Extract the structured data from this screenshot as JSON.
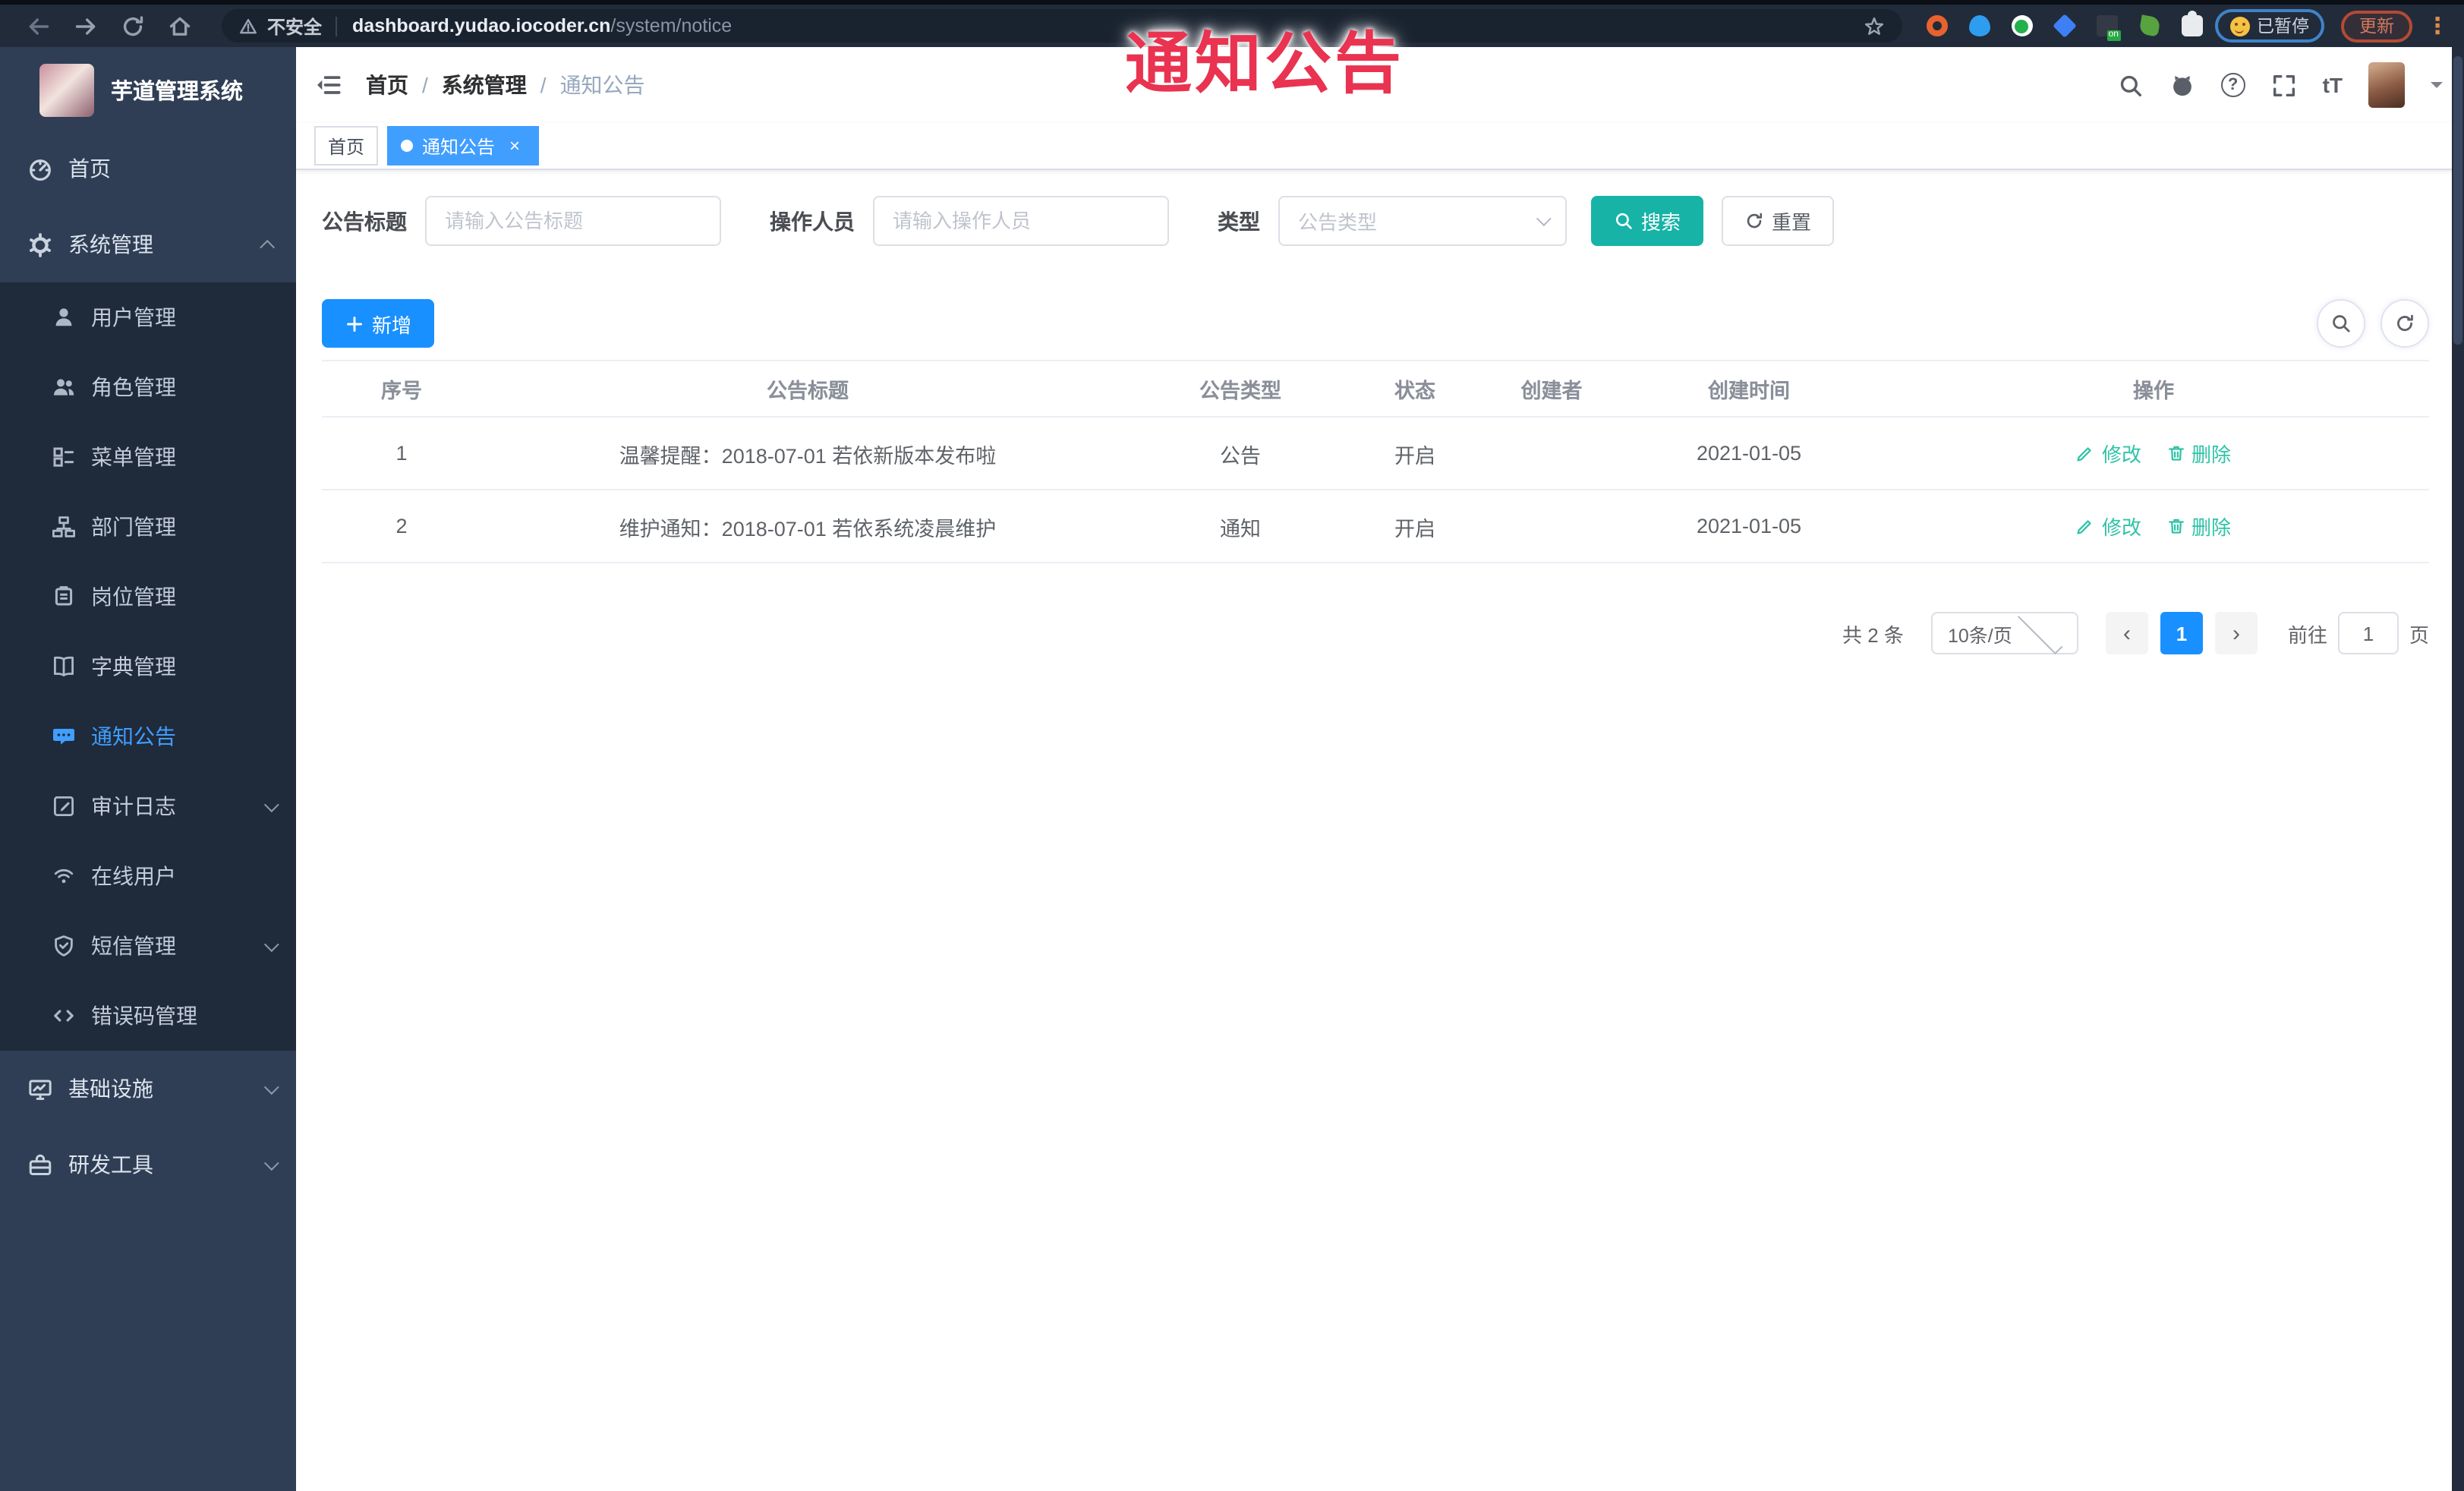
{
  "browser": {
    "security_label": "不安全",
    "url_host": "dashboard.yudao.iocoder.cn",
    "url_path": "/system/notice",
    "paused_label": "已暂停",
    "update_label": "更新"
  },
  "overlay": {
    "title": "通知公告"
  },
  "colors": {
    "accent_blue": "#1890ff",
    "tag_active_blue": "#409eff",
    "search_teal": "#17b3a6",
    "action_link_teal": "#2fc3a7",
    "overlay_red": "#e93350",
    "sidebar_bg": "#2f3e55",
    "submenu_bg": "#1f2a3a"
  },
  "sidebar": {
    "app_title": "芋道管理系统",
    "top_items": [
      {
        "label": "首页",
        "icon": "dashboard-icon"
      },
      {
        "label": "系统管理",
        "icon": "gear-icon",
        "expanded": true
      }
    ],
    "submenu": [
      {
        "label": "用户管理",
        "icon": "user-icon"
      },
      {
        "label": "角色管理",
        "icon": "users-icon"
      },
      {
        "label": "菜单管理",
        "icon": "menu-list-icon"
      },
      {
        "label": "部门管理",
        "icon": "org-tree-icon"
      },
      {
        "label": "岗位管理",
        "icon": "badge-icon"
      },
      {
        "label": "字典管理",
        "icon": "book-icon"
      },
      {
        "label": "通知公告",
        "icon": "chat-bubble-icon",
        "active": true
      },
      {
        "label": "审计日志",
        "icon": "log-icon",
        "expandable": true
      },
      {
        "label": "在线用户",
        "icon": "online-icon"
      },
      {
        "label": "短信管理",
        "icon": "shield-icon",
        "expandable": true
      },
      {
        "label": "错误码管理",
        "icon": "code-icon"
      }
    ],
    "bottom_items": [
      {
        "label": "基础设施",
        "icon": "monitor-icon",
        "expandable": true
      },
      {
        "label": "研发工具",
        "icon": "toolbox-icon",
        "expandable": true
      }
    ]
  },
  "header": {
    "breadcrumb": [
      "首页",
      "系统管理",
      "通知公告"
    ]
  },
  "tags": [
    {
      "label": "首页",
      "active": false
    },
    {
      "label": "通知公告",
      "active": true
    }
  ],
  "filters": {
    "title_label": "公告标题",
    "title_placeholder": "请输入公告标题",
    "operator_label": "操作人员",
    "operator_placeholder": "请输入操作人员",
    "type_label": "类型",
    "type_placeholder": "公告类型",
    "search_label": "搜索",
    "reset_label": "重置"
  },
  "toolbar": {
    "add_label": "新增"
  },
  "table": {
    "columns": [
      "序号",
      "公告标题",
      "公告类型",
      "状态",
      "创建者",
      "创建时间",
      "操作"
    ],
    "rows": [
      {
        "index": "1",
        "title": "温馨提醒：2018-07-01 若依新版本发布啦",
        "type": "公告",
        "status": "开启",
        "creator": "",
        "created_at": "2021-01-05"
      },
      {
        "index": "2",
        "title": "维护通知：2018-07-01 若依系统凌晨维护",
        "type": "通知",
        "status": "开启",
        "creator": "",
        "created_at": "2021-01-05"
      }
    ],
    "edit_label": "修改",
    "delete_label": "删除"
  },
  "pagination": {
    "total_label": "共 2 条",
    "page_size_label": "10条/页",
    "current_page": "1",
    "goto_label": "前往",
    "goto_value": "1",
    "page_unit_label": "页"
  }
}
